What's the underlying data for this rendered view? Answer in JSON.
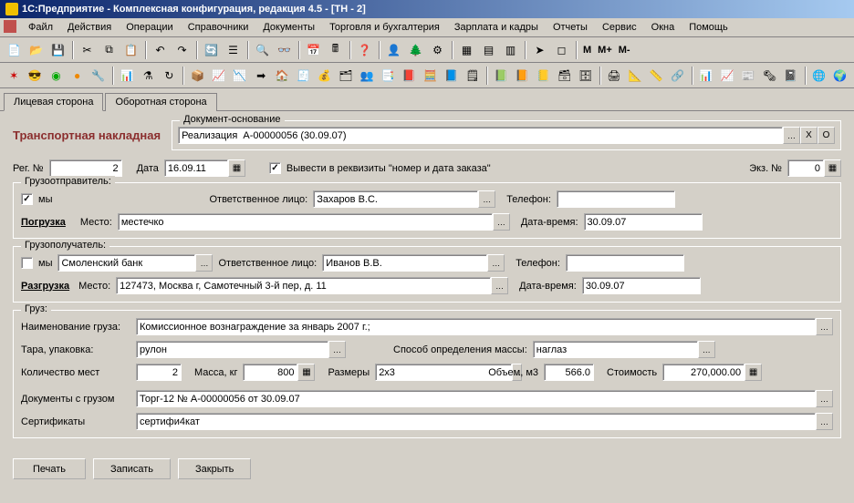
{
  "window": {
    "title": "1С:Предприятие - Комплексная конфигурация, редакция 4.5 - [ТН - 2]"
  },
  "menu": {
    "items": [
      "Файл",
      "Действия",
      "Операции",
      "Справочники",
      "Документы",
      "Торговля и бухгалтерия",
      "Зарплата и кадры",
      "Отчеты",
      "Сервис",
      "Окна",
      "Помощь"
    ]
  },
  "toolbar1": {
    "text_items": [
      "M",
      "M+",
      "M-"
    ]
  },
  "tabs": {
    "items": [
      "Лицевая сторона",
      "Оборотная сторона"
    ],
    "active": 0
  },
  "doc": {
    "title": "Транспортная накладная",
    "basis_group_label": "Документ-основание",
    "basis_value": "Реализация  А-00000056 (30.09.07)",
    "reg_no_label": "Рег. №",
    "reg_no": "2",
    "date_label": "Дата",
    "date": "16.09.11",
    "show_requisites_label": "Вывести в реквизиты \"номер и дата заказа\"",
    "copy_no_label": "Экз. №",
    "copy_no": "0"
  },
  "sender": {
    "group_label": "Грузоотправитель:",
    "we_label": "мы",
    "we_checked": true,
    "resp_label": "Ответственное лицо:",
    "resp_value": "Захаров В.С.",
    "phone_label": "Телефон:",
    "phone_value": "",
    "load_label": "Погрузка",
    "place_label": "Место:",
    "place_value": "местечко",
    "dt_label": "Дата-время:",
    "dt_value": "30.09.07"
  },
  "receiver": {
    "group_label": "Грузополучатель:",
    "we_label": "мы",
    "we_checked": false,
    "org_value": "Смоленский банк",
    "resp_label": "Ответственное лицо:",
    "resp_value": "Иванов В.В.",
    "phone_label": "Телефон:",
    "phone_value": "",
    "unload_label": "Разгрузка",
    "place_label": "Место:",
    "place_value": "127473, Москва г, Самотечный 3-й пер, д. 11",
    "dt_label": "Дата-время:",
    "dt_value": "30.09.07"
  },
  "cargo": {
    "group_label": "Груз:",
    "name_label": "Наименование груза:",
    "name_value": "Комиссионное вознаграждение за январь 2007 г.;",
    "pack_label": "Тара, упаковка:",
    "pack_value": "рулон",
    "mass_method_label": "Способ определения массы:",
    "mass_method_value": "наглаз",
    "places_label": "Количество мест",
    "places_value": "2",
    "mass_label": "Масса, кг",
    "mass_value": "800",
    "dims_label": "Размеры",
    "dims_value": "2x3",
    "volume_label": "Объем, м3",
    "volume_value": "566.0",
    "cost_label": "Стоимость",
    "cost_value": "270,000.00",
    "docs_label": "Документы с грузом",
    "docs_value": "Торг-12 № А-00000056 от 30.09.07",
    "cert_label": "Сертификаты",
    "cert_value": "сертифи4кат"
  },
  "buttons": {
    "print": "Печать",
    "save": "Записать",
    "close": "Закрыть"
  }
}
